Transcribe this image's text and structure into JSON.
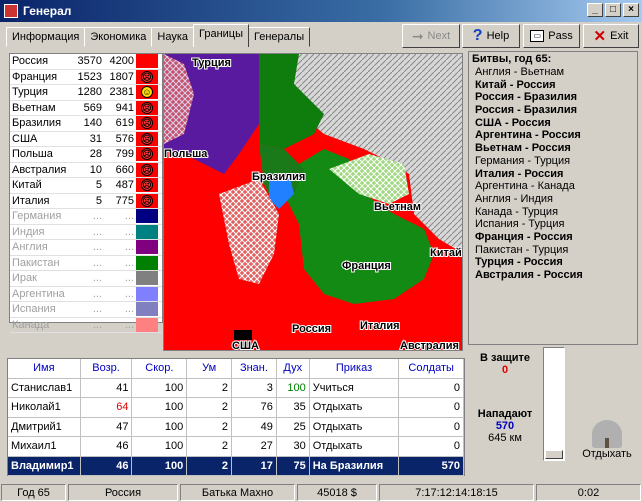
{
  "window": {
    "title": "Генерал",
    "min": "_",
    "max": "□",
    "close": "×"
  },
  "tabs": [
    "Информация",
    "Экономика",
    "Наука",
    "Границы",
    "Генералы"
  ],
  "toolbar": {
    "next": "Next",
    "help": "Help",
    "pass": "Pass",
    "exit": "Exit"
  },
  "countries": [
    {
      "name": "Россия",
      "v1": "3570",
      "v2": "4200",
      "color": "#ff0000",
      "mood": ""
    },
    {
      "name": "Франция",
      "v1": "1523",
      "v2": "1807",
      "color": "#ff0000",
      "mood": "sad"
    },
    {
      "name": "Турция",
      "v1": "1280",
      "v2": "2381",
      "color": "#ff0000",
      "mood": "happy"
    },
    {
      "name": "Вьетнам",
      "v1": "569",
      "v2": "941",
      "color": "#ff0000",
      "mood": "sad"
    },
    {
      "name": "Бразилия",
      "v1": "140",
      "v2": "619",
      "color": "#ff0000",
      "mood": "sad"
    },
    {
      "name": "США",
      "v1": "31",
      "v2": "576",
      "color": "#ff0000",
      "mood": "sad"
    },
    {
      "name": "Польша",
      "v1": "28",
      "v2": "799",
      "color": "#ff0000",
      "mood": "sad"
    },
    {
      "name": "Австралия",
      "v1": "10",
      "v2": "660",
      "color": "#ff0000",
      "mood": "sad"
    },
    {
      "name": "Китай",
      "v1": "5",
      "v2": "487",
      "color": "#ff0000",
      "mood": "sad"
    },
    {
      "name": "Италия",
      "v1": "5",
      "v2": "775",
      "color": "#ff0000",
      "mood": "sad"
    },
    {
      "name": "Германия",
      "v1": "...",
      "v2": "...",
      "color": "#000080",
      "mood": ""
    },
    {
      "name": "Индия",
      "v1": "...",
      "v2": "...",
      "color": "#008080",
      "mood": ""
    },
    {
      "name": "Англия",
      "v1": "...",
      "v2": "...",
      "color": "#800080",
      "mood": ""
    },
    {
      "name": "Пакистан",
      "v1": "...",
      "v2": "...",
      "color": "#008000",
      "mood": ""
    },
    {
      "name": "Ирак",
      "v1": "...",
      "v2": "...",
      "color": "#808080",
      "mood": ""
    },
    {
      "name": "Аргентина",
      "v1": "...",
      "v2": "...",
      "color": "#8080ff",
      "mood": ""
    },
    {
      "name": "Испания",
      "v1": "...",
      "v2": "...",
      "color": "#8080c0",
      "mood": ""
    },
    {
      "name": "Канада",
      "v1": "...",
      "v2": "...",
      "color": "#ff8080",
      "mood": ""
    }
  ],
  "map_labels": {
    "turkey": "Турция",
    "poland": "Польша",
    "brazil": "Бразилия",
    "vietnam": "Вьетнам",
    "china": "Китай",
    "france": "Франция",
    "russia": "Россия",
    "italy": "Италия",
    "usa": "США",
    "australia": "Австралия"
  },
  "battles": {
    "header": "Битвы, год 65:",
    "items": [
      {
        "text": "Англия - Вьетнам",
        "bold": false
      },
      {
        "text": "Китай - Россия",
        "bold": true
      },
      {
        "text": "Россия - Бразилия",
        "bold": true
      },
      {
        "text": "Россия - Бразилия",
        "bold": true
      },
      {
        "text": "США - Россия",
        "bold": true
      },
      {
        "text": "Аргентина - Россия",
        "bold": true
      },
      {
        "text": "Вьетнам - Россия",
        "bold": true
      },
      {
        "text": "Германия - Турция",
        "bold": false
      },
      {
        "text": "Италия - Россия",
        "bold": true
      },
      {
        "text": "Аргентина - Канада",
        "bold": false
      },
      {
        "text": "Англия - Индия",
        "bold": false
      },
      {
        "text": "Канада - Турция",
        "bold": false
      },
      {
        "text": "Испания - Турция",
        "bold": false
      },
      {
        "text": "Франция - Россия",
        "bold": true
      },
      {
        "text": "Пакистан - Турция",
        "bold": false
      },
      {
        "text": "Турция - Россия",
        "bold": true
      },
      {
        "text": "Австралия - Россия",
        "bold": true
      }
    ]
  },
  "generals": {
    "headers": [
      "Имя",
      "Возр.",
      "Скор.",
      "Ум",
      "Знан.",
      "Дух",
      "Приказ",
      "Солдаты"
    ],
    "rows": [
      {
        "name": "Станислав1",
        "age": "41",
        "speed": "100",
        "mind": "2",
        "know": "3",
        "spirit": "100",
        "order": "Учиться",
        "soldiers": "0",
        "age_color": "#000",
        "spirit_color": "#008000"
      },
      {
        "name": "Николай1",
        "age": "64",
        "speed": "100",
        "mind": "2",
        "know": "76",
        "spirit": "35",
        "order": "Отдыхать",
        "soldiers": "0",
        "age_color": "#e00000",
        "spirit_color": "#000"
      },
      {
        "name": "Дмитрий1",
        "age": "47",
        "speed": "100",
        "mind": "2",
        "know": "49",
        "spirit": "25",
        "order": "Отдыхать",
        "soldiers": "0",
        "age_color": "#000",
        "spirit_color": "#000"
      },
      {
        "name": "Михаил1",
        "age": "46",
        "speed": "100",
        "mind": "2",
        "know": "27",
        "spirit": "30",
        "order": "Отдыхать",
        "soldiers": "0",
        "age_color": "#000",
        "spirit_color": "#000"
      },
      {
        "name": "Владимир1",
        "age": "46",
        "speed": "100",
        "mind": "2",
        "know": "17",
        "spirit": "75",
        "order": "На Бразилия",
        "soldiers": "570",
        "age_color": "#fff",
        "spirit_color": "#fff"
      }
    ]
  },
  "defense": {
    "label": "В защите",
    "value": "0",
    "attack_label": "Нападают",
    "attack_value": "570",
    "distance": "645 км",
    "rest_label": "Отдыхать"
  },
  "status": {
    "year": "Год 65",
    "country": "Россия",
    "leader": "Батька Махно",
    "money": "45018 $",
    "time": "7:17:12:14:18:15",
    "clock": "0:02"
  }
}
